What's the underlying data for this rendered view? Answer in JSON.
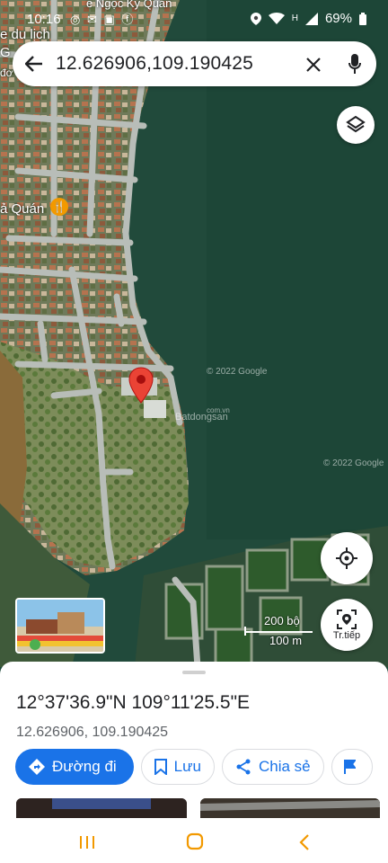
{
  "status_bar": {
    "time": "10:16",
    "notification_icons": "◎ ✉ ▣ ⓕ",
    "signal": "H",
    "battery": "69%"
  },
  "search": {
    "query": "12.626906,109.190425"
  },
  "map": {
    "place_label_1": "e du lịch",
    "place_label_2": "G",
    "place_label_3": "đơ",
    "place_label_4": "ả Quán",
    "top_label": "e Ngọc Ký Quán",
    "watermark_1": "© 2022 Google",
    "watermark_2": "Batdongsan",
    "watermark_3": "© 2022 Google",
    "watermark_4": "com.vn",
    "scale_ft": "200 bộ",
    "scale_m": "100 m",
    "navigate_label": "Tr.tiếp",
    "pin_color": "#ea4335"
  },
  "sheet": {
    "title": "12°37'36.9\"N 109°11'25.5\"E",
    "subtitle": "12.626906, 109.190425",
    "actions": {
      "directions": "Đường đi",
      "save": "Lưu",
      "share": "Chia sẻ"
    }
  },
  "colors": {
    "accent": "#1a73e8",
    "nav_icons": "#f29900"
  }
}
